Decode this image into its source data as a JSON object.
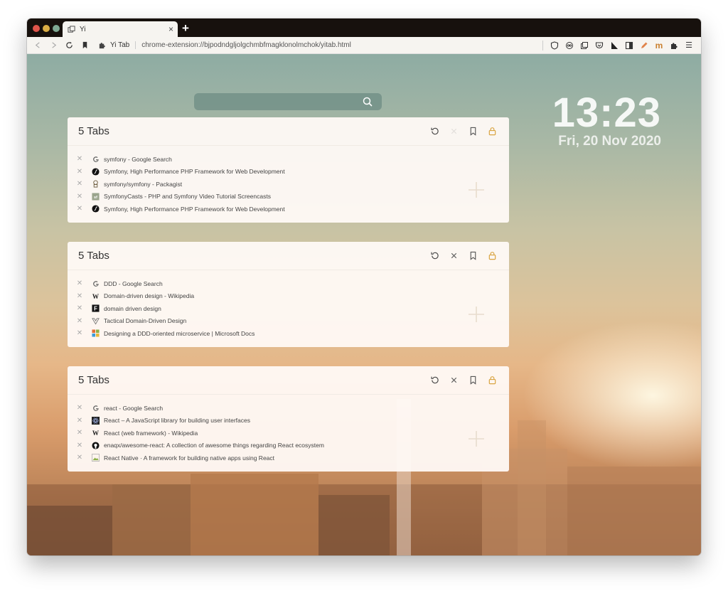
{
  "browser": {
    "tab_title": "Yi",
    "tab_close": "×",
    "new_tab": "+",
    "extension_name": "Yi Tab",
    "url": "chrome-extension://bjpodndgljolgchmbfmagklonolmchok/yitab.html",
    "toolbar_icons": [
      "shield-icon",
      "reader-icon",
      "collections-icon",
      "pocket-icon",
      "flag-icon",
      "sidebar-icon",
      "pen-icon",
      "m-icon",
      "puzzle-icon",
      "menu-icon"
    ],
    "m_label": "m",
    "menu_label": "☰"
  },
  "search": {
    "placeholder": "",
    "value": ""
  },
  "clock": {
    "time": "13:23",
    "date": "Fri, 20 Nov 2020"
  },
  "colors": {
    "accent": "#d9a441",
    "panel_bg": "#fffaf6",
    "text": "#333333"
  },
  "groups": [
    {
      "title": "5 Tabs",
      "tabs": [
        {
          "favicon": "google-icon",
          "title": "symfony - Google Search"
        },
        {
          "favicon": "symfony-icon",
          "title": "Symfony, High Performance PHP Framework for Web Development"
        },
        {
          "favicon": "packagist-icon",
          "title": "symfony/symfony - Packagist"
        },
        {
          "favicon": "symfonycasts-icon",
          "title": "SymfonyCasts - PHP and Symfony Video Tutorial Screencasts"
        },
        {
          "favicon": "symfony-icon",
          "title": "Symfony, High Performance PHP Framework for Web Development"
        }
      ]
    },
    {
      "title": "5 Tabs",
      "tabs": [
        {
          "favicon": "google-icon",
          "title": "DDD - Google Search"
        },
        {
          "favicon": "wikipedia-icon",
          "title": "Domain-driven design - Wikipedia"
        },
        {
          "favicon": "f-icon",
          "title": "domain driven design"
        },
        {
          "favicon": "vue-icon",
          "title": "Tactical Domain-Driven Design"
        },
        {
          "favicon": "microsoft-icon",
          "title": "Designing a DDD-oriented microservice | Microsoft Docs"
        }
      ]
    },
    {
      "title": "5 Tabs",
      "tabs": [
        {
          "favicon": "google-icon",
          "title": "react - Google Search"
        },
        {
          "favicon": "react-icon",
          "title": "React – A JavaScript library for building user interfaces"
        },
        {
          "favicon": "wikipedia-icon",
          "title": "React (web framework) - Wikipedia"
        },
        {
          "favicon": "github-icon",
          "title": "enaqx/awesome-react: A collection of awesome things regarding React ecosystem"
        },
        {
          "favicon": "image-icon",
          "title": "React Native · A framework for building native apps using React"
        }
      ]
    }
  ]
}
